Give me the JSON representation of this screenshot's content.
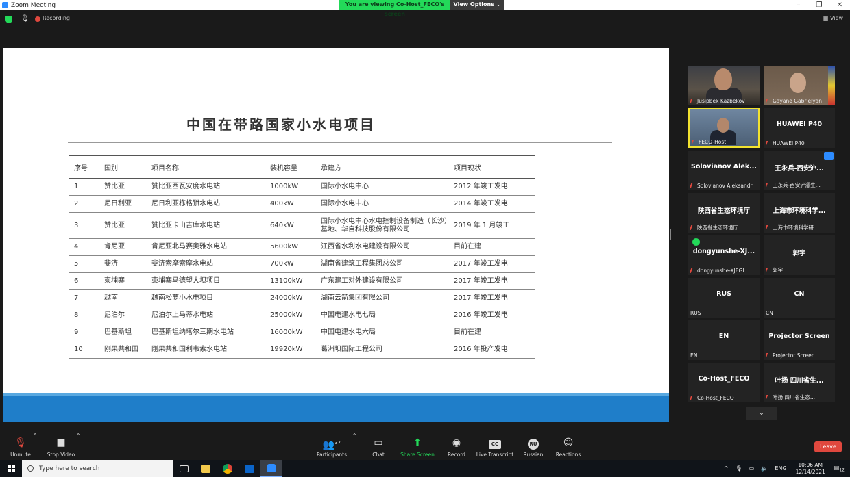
{
  "window": {
    "title": "Zoom Meeting",
    "minimize": "–",
    "maximize": "❐",
    "close": "✕"
  },
  "banner": {
    "viewing": "You are viewing Co-Host_FECO's screen",
    "view_options": "View Options ⌄"
  },
  "topbar": {
    "recording": "Recording",
    "view": "View"
  },
  "slide": {
    "title": "中国在带路国家小水电项目",
    "columns": [
      "序号",
      "国别",
      "项目名称",
      "装机容量",
      "承建方",
      "项目现状"
    ],
    "rows": [
      [
        "1",
        "赞比亚",
        "赞比亚西瓦安度水电站",
        "1000kW",
        "国际小水电中心",
        "2012 年竣工发电"
      ],
      [
        "2",
        "尼日利亚",
        "尼日利亚栋格锁水电站",
        "400kW",
        "国际小水电中心",
        "2014 年竣工发电"
      ],
      [
        "3",
        "赞比亚",
        "赞比亚卡山吉库水电站",
        "640kW",
        "国际小水电中心水电控制设备制造（长沙）基地、华自科技股份有限公司",
        "2019 年 1 月竣工"
      ],
      [
        "4",
        "肯尼亚",
        "肯尼亚北马赛奥雅水电站",
        "5600kW",
        "江西省水利水电建设有限公司",
        "目前在建"
      ],
      [
        "5",
        "斐济",
        "斐济索摩索摩水电站",
        "700kW",
        "湖南省建筑工程集团总公司",
        "2017 年竣工发电"
      ],
      [
        "6",
        "柬埔寨",
        "柬埔寨马德望大坝项目",
        "13100kW",
        "广东建工对外建设有限公司",
        "2017 年竣工发电"
      ],
      [
        "7",
        "越南",
        "越南松萝小水电项目",
        "24000kW",
        "湖南云箭集团有限公司",
        "2017 年竣工发电"
      ],
      [
        "8",
        "尼泊尔",
        "尼泊尔上马蒂水电站",
        "25000kW",
        "中国电建水电七局",
        "2016 年竣工发电"
      ],
      [
        "9",
        "巴基斯坦",
        "巴基斯坦纳塔尔三期水电站",
        "16000kW",
        "中国电建水电六局",
        "目前在建"
      ],
      [
        "10",
        "刚果共和国",
        "刚果共和国利韦索水电站",
        "19920kW",
        "葛洲坝国际工程公司",
        "2016 年投产发电"
      ]
    ]
  },
  "gallery": [
    {
      "name": "",
      "label": "Jusipbek Kazbekov",
      "kind": "face1"
    },
    {
      "name": "",
      "label": "Gayane Gabrielyan",
      "kind": "face2"
    },
    {
      "name": "",
      "label": "FECO-Host",
      "kind": "face3"
    },
    {
      "name": "HUAWEI P40",
      "label": "HUAWEI P40",
      "kind": "text"
    },
    {
      "name": "Solovianov Alek...",
      "label": "Solovianov Aleksandr",
      "kind": "text"
    },
    {
      "name": "王永兵-西安沪...",
      "label": "王永兵-西安浐灞生...",
      "kind": "text",
      "badge": "···"
    },
    {
      "name": "陕西省生态环境厅",
      "label": "陕西省生态环境厅",
      "kind": "text"
    },
    {
      "name": "上海市环境科学...",
      "label": "上海市环境科学研...",
      "kind": "text"
    },
    {
      "name": "dongyunshe-XJ...",
      "label": "dongyunshe-XJEGI",
      "kind": "text",
      "check": true
    },
    {
      "name": "郭宇",
      "label": "郭宇",
      "kind": "text"
    },
    {
      "name": "RUS",
      "label": "RUS",
      "kind": "text",
      "nomute": true
    },
    {
      "name": "CN",
      "label": "CN",
      "kind": "text",
      "nomute": true
    },
    {
      "name": "EN",
      "label": "EN",
      "kind": "text",
      "nomute": true
    },
    {
      "name": "Projector Screen",
      "label": "Projector Screen",
      "kind": "text"
    },
    {
      "name": "Co-Host_FECO",
      "label": "Co-Host_FECO",
      "kind": "text"
    },
    {
      "name": "叶扬 四川省生...",
      "label": "叶扬 四川省生态...",
      "kind": "text"
    }
  ],
  "toolbar": {
    "unmute": "Unmute",
    "stop_video": "Stop Video",
    "participants": "Participants",
    "participants_count": "37",
    "chat": "Chat",
    "share_screen": "Share Screen",
    "record": "Record",
    "live_transcript": "Live Transcript",
    "cc": "CC",
    "russian": "Russian",
    "ru": "RU",
    "reactions": "Reactions",
    "leave": "Leave"
  },
  "taskbar": {
    "search_placeholder": "Type here to search",
    "lang": "ENG",
    "time": "10:06 AM",
    "date": "12/14/2021",
    "notif_count": "12"
  },
  "colors": {
    "accent_green": "#23d959",
    "leave_red": "#e0483e",
    "zoom_blue": "#2d8cff",
    "slide_footer": "#1f7ec9"
  }
}
